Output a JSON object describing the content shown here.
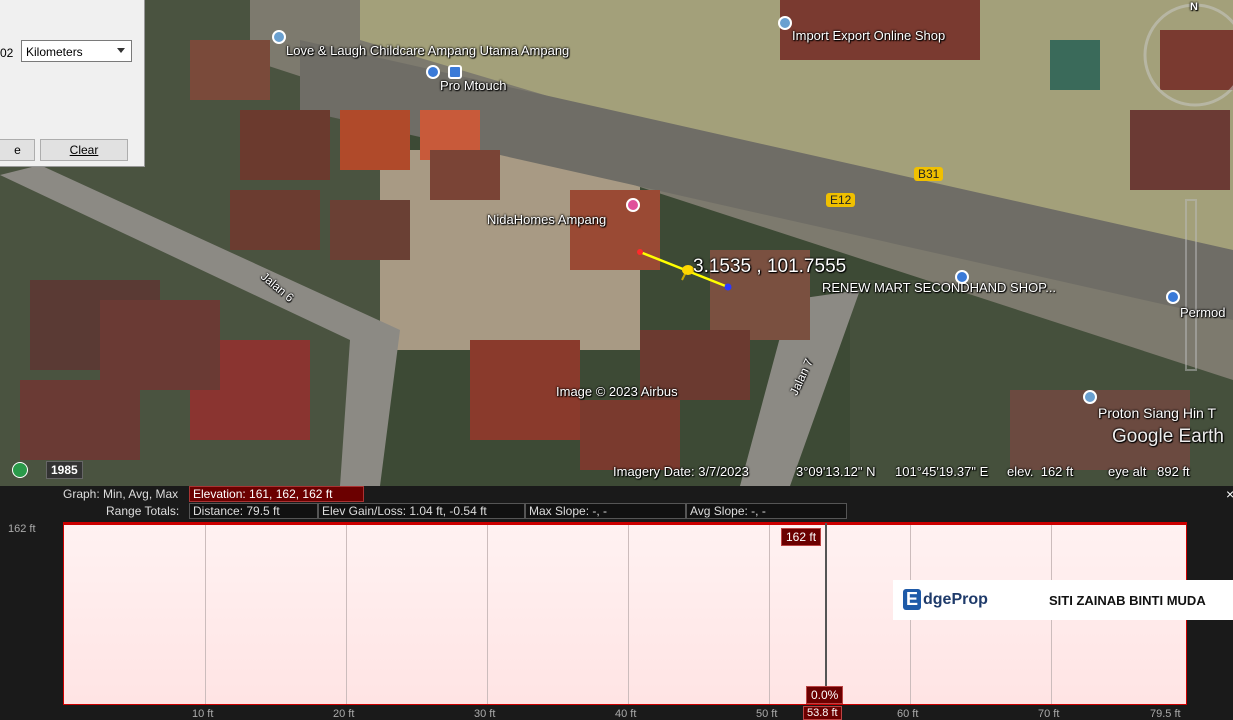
{
  "colors": {
    "profile_fill": "#ffe6e6",
    "profile_line": "#cc0000",
    "path_line": "#ffff00",
    "elevation_box": "#6b0000"
  },
  "panel": {
    "value_fragment": "02",
    "unit_select": "Kilometers",
    "button_left": "e",
    "clear_label": "Clear"
  },
  "map": {
    "labels": {
      "childcare": "Love & Laugh Childcare Ampang Utama Ampang",
      "import_export": "Import Export Online Shop",
      "pro_mtouch": "Pro Mtouch",
      "nida_homes": "NidaHomes Ampang",
      "renew_mart": "RENEW MART SECONDHAND SHOP...",
      "permod": "Permod",
      "proton": "Proton Siang Hin T",
      "jalan6": "Jalan 6",
      "jalan7": "Jalan 7",
      "e12": "E12",
      "b31": "B31",
      "coords_overlay": "3.1535 , 101.7555",
      "image_credit": "Image © 2023 Airbus",
      "google_earth": "Google Earth",
      "compass_n": "N"
    },
    "year": "1985",
    "status": {
      "imagery_date": "Imagery Date: 3/7/2023",
      "lat": "3°09'13.12\" N",
      "lon": "101°45'19.37\" E",
      "elev": "elev.  162 ft",
      "eye_alt": "eye alt   892 ft"
    }
  },
  "profile": {
    "graph_label": "Graph: Min, Avg, Max",
    "elevation_text": "Elevation: 161, 162, 162 ft",
    "range_label": "Range Totals:",
    "distance_text": "Distance: 79.5 ft",
    "gain_loss_text": "Elev Gain/Loss: 1.04 ft, -0.54 ft",
    "max_slope_text": "Max Slope: -, -",
    "avg_slope_text": "Avg Slope: -, -",
    "y_top_label": "162 ft",
    "cursor_elev": "162 ft",
    "cursor_slope": "0.0%",
    "cursor_dist": "53.8 ft",
    "close_label": "×",
    "x_ticks": [
      "10 ft",
      "20 ft",
      "30 ft",
      "40 ft",
      "50 ft",
      "60 ft",
      "70 ft",
      "79.5 ft"
    ],
    "cursor_fraction": 0.677
  },
  "watermark": {
    "brand_prefix": "E",
    "brand_rest": "dgeProp",
    "agent": "SITI ZAINAB BINTI MUDA"
  }
}
